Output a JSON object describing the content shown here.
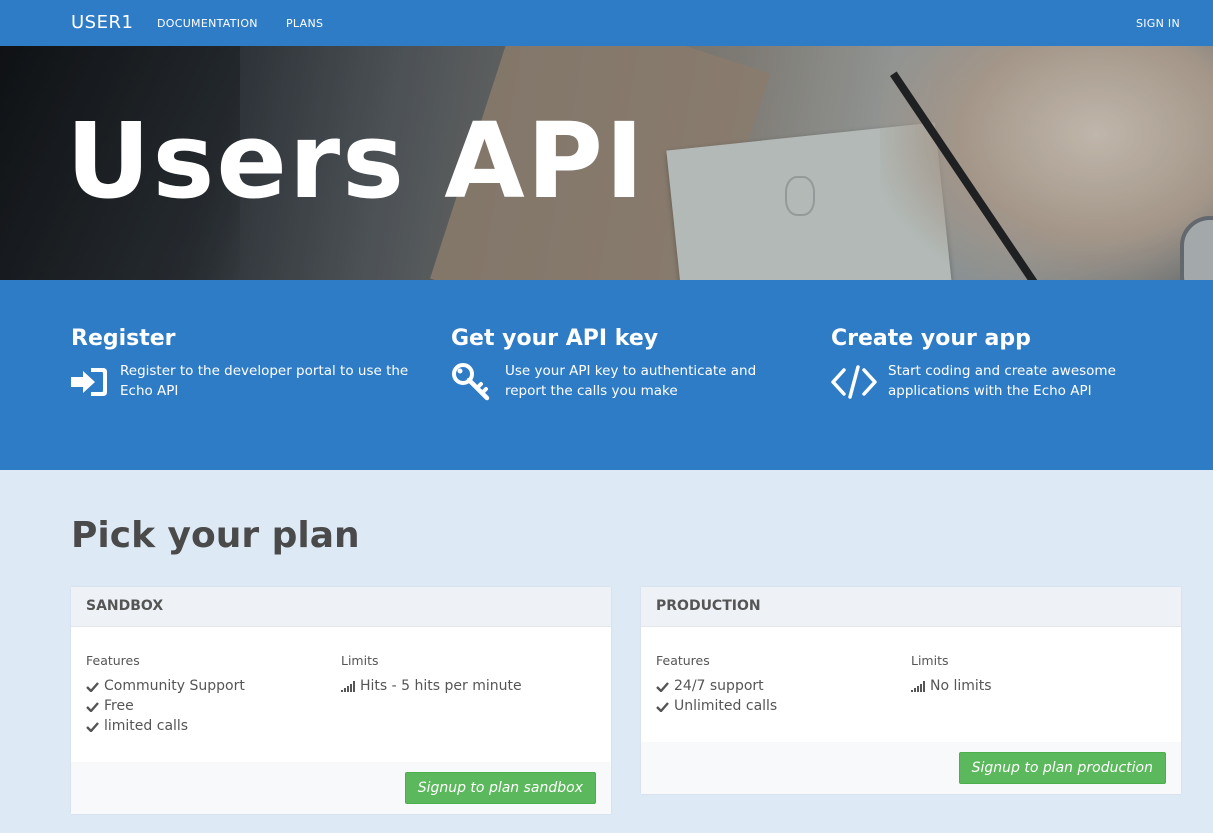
{
  "navbar": {
    "brand": "USER1",
    "links": [
      "DOCUMENTATION",
      "PLANS"
    ],
    "signin": "SIGN IN"
  },
  "hero": {
    "title": "Users API"
  },
  "features": [
    {
      "title": "Register",
      "text": "Register to the developer portal to use the Echo API",
      "icon": "sign-in-icon"
    },
    {
      "title": "Get your API key",
      "text": "Use your API key to authenticate and report the calls you make",
      "icon": "key-icon"
    },
    {
      "title": "Create your app",
      "text": "Start coding and create awesome applications with the Echo API",
      "icon": "code-icon"
    }
  ],
  "plans_section": {
    "title": "Pick your plan",
    "plans": [
      {
        "name": "SANDBOX",
        "features_label": "Features",
        "limits_label": "Limits",
        "features": [
          "Community Support",
          "Free",
          "limited calls"
        ],
        "limits": [
          "Hits - 5 hits per minute"
        ],
        "button": "Signup to plan sandbox"
      },
      {
        "name": "PRODUCTION",
        "features_label": "Features",
        "limits_label": "Limits",
        "features": [
          "24/7 support",
          "Unlimited calls"
        ],
        "limits": [
          "No limits"
        ],
        "button": "Signup to plan production"
      }
    ]
  },
  "colors": {
    "primary": "#2f7cc6",
    "page_bg": "#dde9f5",
    "button_green": "#5cb85c"
  }
}
